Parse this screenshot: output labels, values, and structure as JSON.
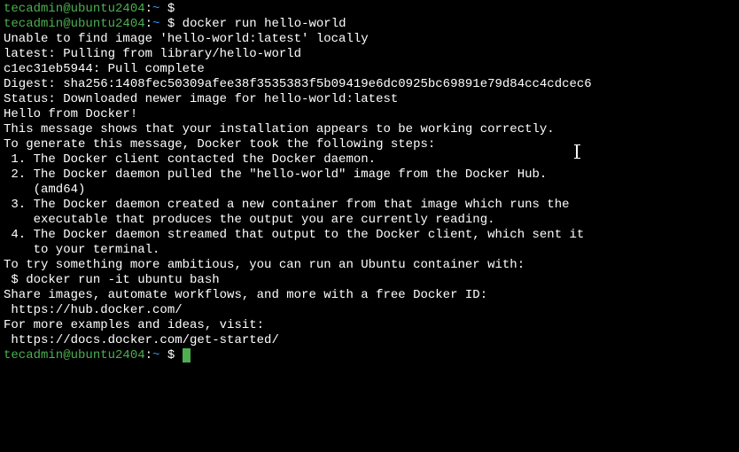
{
  "prompt": {
    "user": "tecadmin",
    "host": "ubuntu2404",
    "path": "~",
    "dollar": "$"
  },
  "cmd1": "",
  "cmd2": "docker run hello-world",
  "out": {
    "l1": "Unable to find image 'hello-world:latest' locally",
    "l2": "latest: Pulling from library/hello-world",
    "l3": "c1ec31eb5944: Pull complete",
    "l4": "Digest: sha256:1408fec50309afee38f3535383f5b09419e6dc0925bc69891e79d84cc4cdcec6",
    "l5": "Status: Downloaded newer image for hello-world:latest",
    "l6": "",
    "l7": "Hello from Docker!",
    "l8": "This message shows that your installation appears to be working correctly.",
    "l9": "",
    "l10": "To generate this message, Docker took the following steps:",
    "l11": " 1. The Docker client contacted the Docker daemon.",
    "l12": " 2. The Docker daemon pulled the \"hello-world\" image from the Docker Hub.",
    "l13": "    (amd64)",
    "l14": " 3. The Docker daemon created a new container from that image which runs the",
    "l15": "    executable that produces the output you are currently reading.",
    "l16": " 4. The Docker daemon streamed that output to the Docker client, which sent it",
    "l17": "    to your terminal.",
    "l18": "",
    "l19": "To try something more ambitious, you can run an Ubuntu container with:",
    "l20": " $ docker run -it ubuntu bash",
    "l21": "",
    "l22": "Share images, automate workflows, and more with a free Docker ID:",
    "l23": " https://hub.docker.com/",
    "l24": "",
    "l25": "For more examples and ideas, visit:",
    "l26": " https://docs.docker.com/get-started/",
    "l27": ""
  }
}
